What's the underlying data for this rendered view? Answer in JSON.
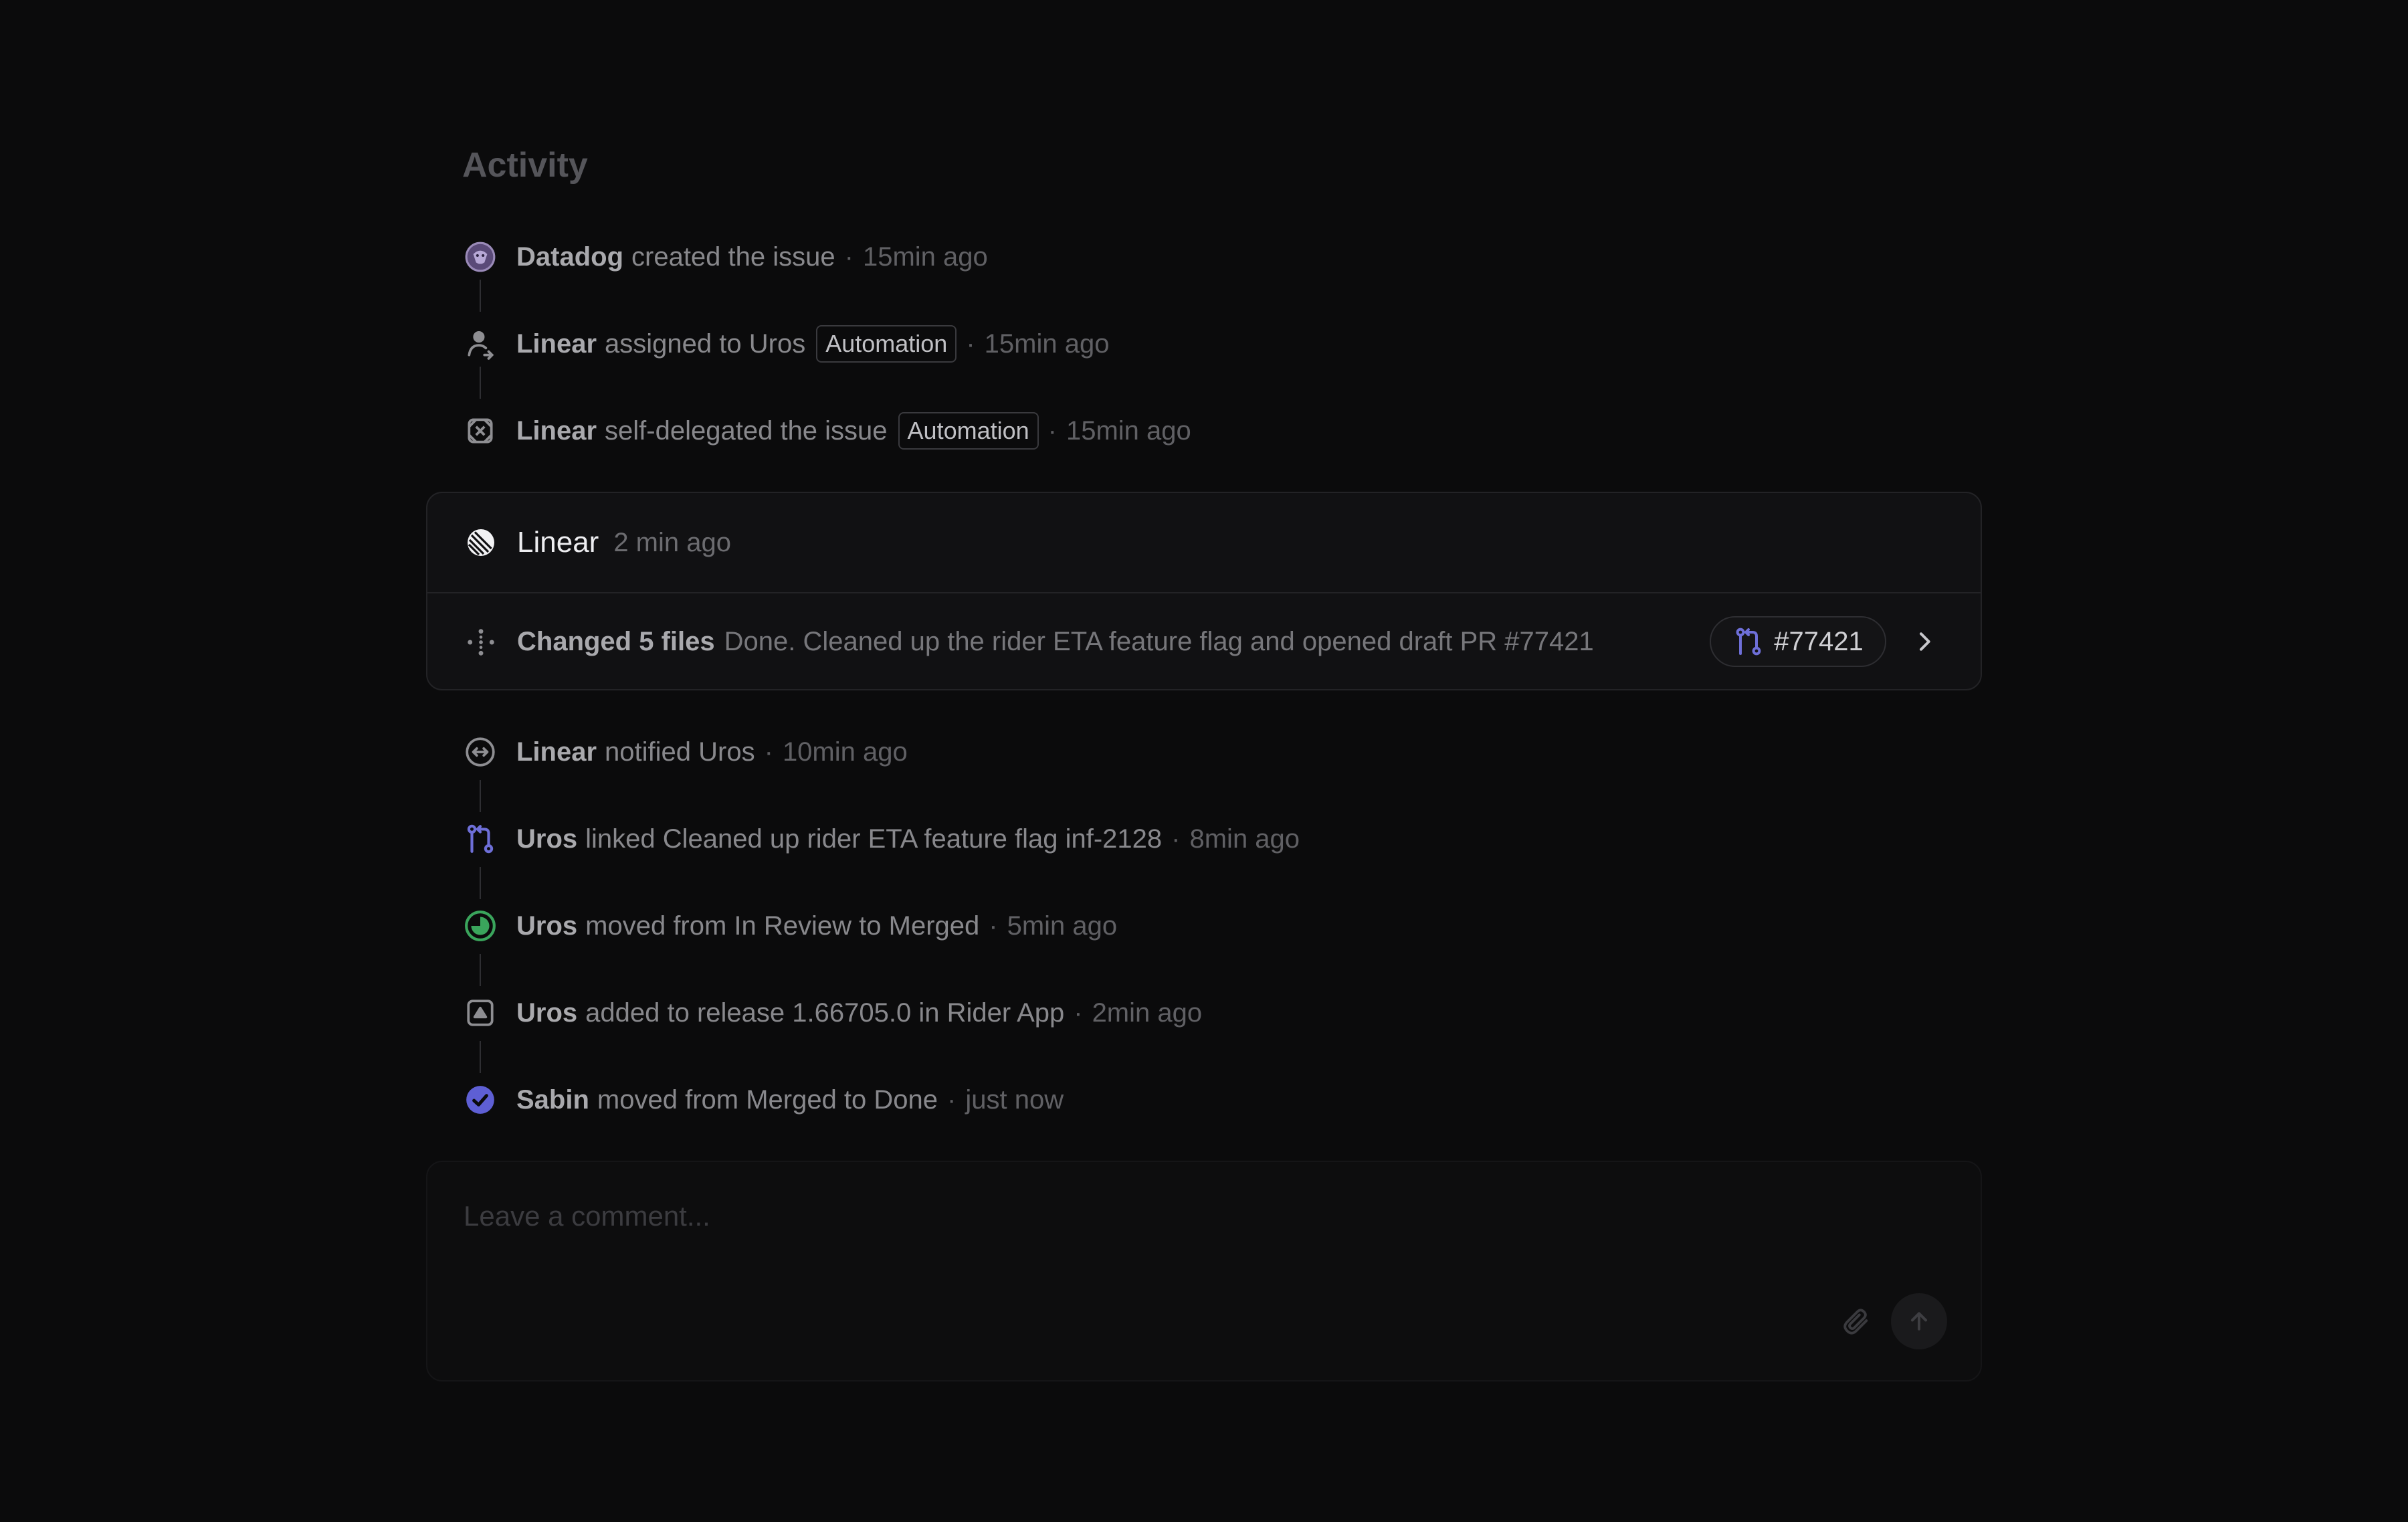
{
  "section": {
    "title": "Activity"
  },
  "activity_top": [
    {
      "icon": "datadog-icon",
      "actor": "Datadog",
      "text": "created the issue",
      "time": "15min ago"
    },
    {
      "icon": "user-assign-icon",
      "actor": "Linear",
      "text": "assigned to Uros",
      "chip": "Automation",
      "time": "15min ago"
    },
    {
      "icon": "delegate-icon",
      "actor": "Linear",
      "text": "self-delegated the issue",
      "chip": "Automation",
      "time": "15min ago"
    }
  ],
  "agent_card": {
    "icon": "linear-logo-icon",
    "name": "Linear",
    "time": "2 min ago",
    "files_label": "Changed 5 files",
    "summary": "Done. Cleaned up the rider ETA feature flag and opened draft PR #77421",
    "pr_label": "#77421",
    "pr_icon": "pull-request-icon",
    "accent": "#6e6fd8"
  },
  "activity_bottom": [
    {
      "icon": "notify-icon",
      "actor": "Linear",
      "text": "notified Uros",
      "time": "10min ago"
    },
    {
      "icon": "pull-request-icon",
      "actor": "Uros",
      "text": "linked Cleaned up rider ETA feature flag inf-2128",
      "time": "8min ago"
    },
    {
      "icon": "merged-status-icon",
      "actor": "Uros",
      "text": "moved from In Review to Merged",
      "time": "5min ago"
    },
    {
      "icon": "release-icon",
      "actor": "Uros",
      "text": "added to release 1.66705.0 in Rider App",
      "time": "2min ago"
    },
    {
      "icon": "done-status-icon",
      "actor": "Sabin",
      "text": "moved from Merged to Done",
      "time": "just now"
    }
  ],
  "separator": "·",
  "composer": {
    "placeholder": "Leave a comment..."
  },
  "colors": {
    "background": "#0b0b0c",
    "merged_green": "#3aa55c",
    "done_purple": "#5e5fd4",
    "pr_blue": "#6e6fd8"
  }
}
